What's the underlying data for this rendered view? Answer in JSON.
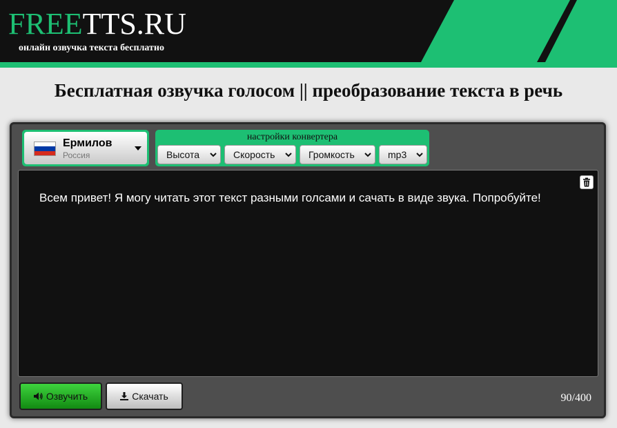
{
  "header": {
    "logo_part1": "FREE",
    "logo_part2": "TTS.RU",
    "tagline": "онлайн озвучка текста бесплатно"
  },
  "page_title": "Бесплатная озвучка голосом || преобразование текста в речь",
  "voice": {
    "name": "Ермилов",
    "country": "Россия"
  },
  "settings": {
    "title": "настройки конвертера",
    "pitch": "Высота",
    "speed": "Скорость",
    "volume": "Громкость",
    "format": "mp3"
  },
  "editor": {
    "text": "Всем привет! Я могу читать этот текст разными голсами и сачать в виде звука. Попробуйте!"
  },
  "actions": {
    "speak_label": "Озвучить",
    "download_label": "Скачать"
  },
  "counter": "90/400",
  "colors": {
    "accent": "#1dbf73",
    "header_bg": "#111111",
    "panel_bg": "#4e4e4e"
  },
  "icons": {
    "voice_dropdown": "caret-down-icon",
    "flag": "russia-flag-icon",
    "select": "chevron-down-icon",
    "clear": "trash-icon",
    "speak": "volume-icon",
    "download": "download-icon"
  }
}
